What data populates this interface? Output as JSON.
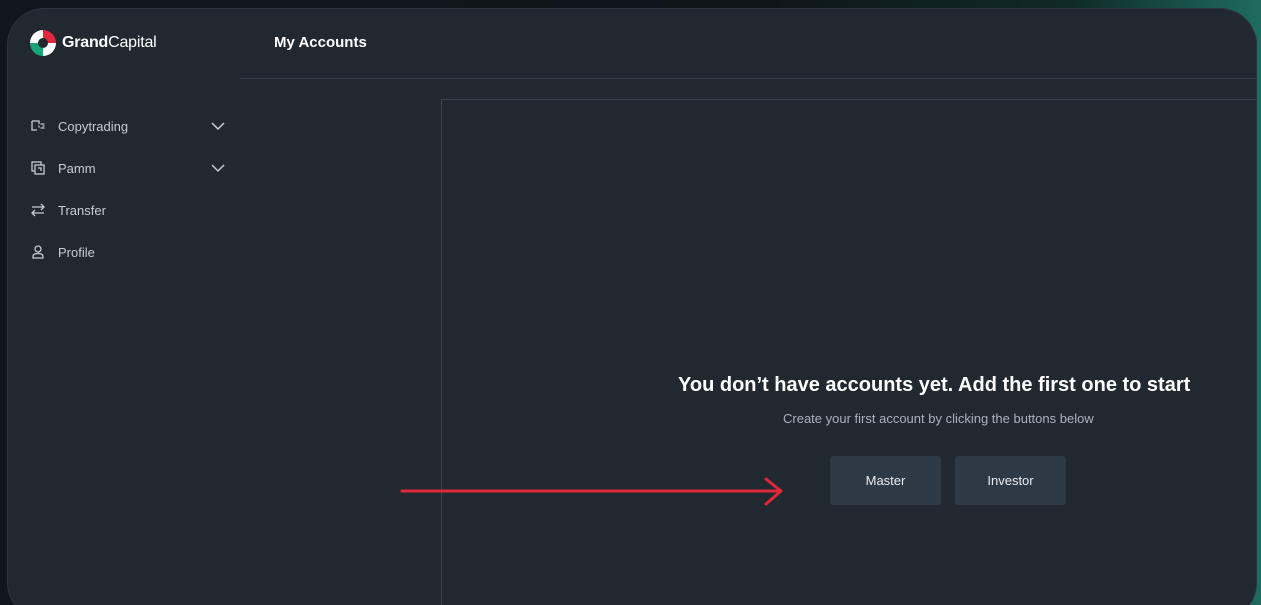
{
  "brand": {
    "name_bold": "Grand",
    "name_light": "Capital"
  },
  "header": {
    "title": "My Accounts"
  },
  "sidebar": {
    "items": [
      {
        "label": "Copytrading",
        "icon": "copytrading-icon",
        "expandable": true
      },
      {
        "label": "Pamm",
        "icon": "pamm-icon",
        "expandable": true
      },
      {
        "label": "Transfer",
        "icon": "transfer-icon",
        "expandable": false
      },
      {
        "label": "Profile",
        "icon": "user-icon",
        "expandable": false
      }
    ]
  },
  "empty_state": {
    "title": "You don’t have accounts yet. Add the first one to start",
    "subtitle": "Create your first account by clicking the buttons below"
  },
  "actions": {
    "master_label": "Master",
    "investor_label": "Investor"
  },
  "colors": {
    "background": "#212830",
    "button": "#2e3946",
    "annotation_arrow": "#e0283a",
    "logo_red": "#e0283a",
    "logo_green": "#1aa37a"
  }
}
